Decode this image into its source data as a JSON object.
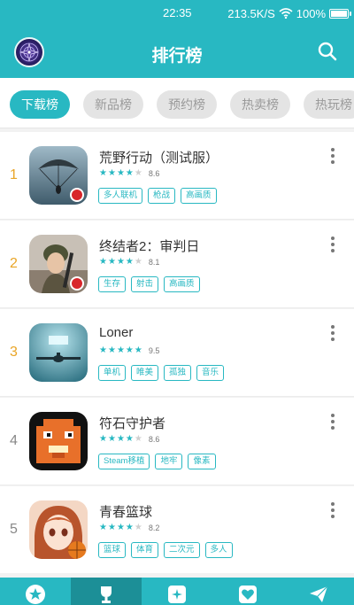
{
  "status_bar": {
    "time": "22:35",
    "speed": "213.5K/S",
    "battery": "100%"
  },
  "header": {
    "title": "排行榜",
    "avatar": "avatar-mandala",
    "search_icon": "search-icon"
  },
  "tabs": [
    {
      "label": "下载榜",
      "active": true
    },
    {
      "label": "新品榜",
      "active": false
    },
    {
      "label": "预约榜",
      "active": false
    },
    {
      "label": "热卖榜",
      "active": false
    },
    {
      "label": "热玩榜",
      "active": false
    }
  ],
  "apps": [
    {
      "rank": "1",
      "name": "荒野行动（测试服）",
      "rating_stars": 4.5,
      "score": "8.6",
      "tags": [
        "多人联机",
        "枪战",
        "高画质"
      ],
      "icon": "parachute-icon"
    },
    {
      "rank": "2",
      "name": "终结者2：审判日",
      "rating_stars": 4.0,
      "score": "8.1",
      "tags": [
        "生存",
        "射击",
        "高画质"
      ],
      "icon": "soldier-icon"
    },
    {
      "rank": "3",
      "name": "Loner",
      "rating_stars": 5.0,
      "score": "9.5",
      "tags": [
        "单机",
        "唯美",
        "孤独",
        "音乐"
      ],
      "icon": "plane-icon"
    },
    {
      "rank": "4",
      "name": "符石守护者",
      "rating_stars": 4.5,
      "score": "8.6",
      "tags": [
        "Steam移植",
        "地牢",
        "像素"
      ],
      "icon": "pixel-monster-icon"
    },
    {
      "rank": "5",
      "name": "青春篮球",
      "rating_stars": 4.0,
      "score": "8.2",
      "tags": [
        "篮球",
        "体育",
        "二次元",
        "多人"
      ],
      "icon": "anime-girl-icon"
    }
  ],
  "bottom_nav": [
    {
      "icon": "star-icon",
      "active": false
    },
    {
      "icon": "trophy-icon",
      "active": true
    },
    {
      "icon": "sparkle-icon",
      "active": false
    },
    {
      "icon": "heart-icon",
      "active": false
    },
    {
      "icon": "paper-plane-icon",
      "active": false
    }
  ],
  "colors": {
    "accent": "#28b8c2",
    "rank_top": "#e9a526"
  }
}
